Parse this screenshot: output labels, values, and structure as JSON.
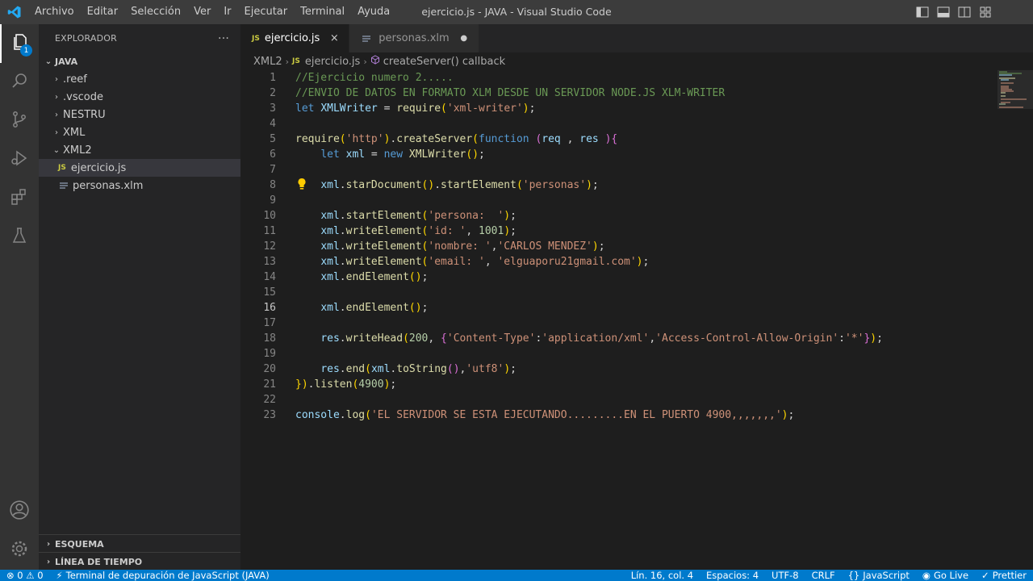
{
  "menu": [
    "Archivo",
    "Editar",
    "Selección",
    "Ver",
    "Ir",
    "Ejecutar",
    "Terminal",
    "Ayuda"
  ],
  "window_title": "ejercicio.js - JAVA - Visual Studio Code",
  "activity": {
    "explorer_badge": "1"
  },
  "sidebar": {
    "header": "EXPLORADOR",
    "more": "···",
    "root": "JAVA",
    "folders": [
      ".reef",
      ".vscode",
      "NESTRU",
      "XML"
    ],
    "open_folder": "XML2",
    "files": [
      "ejercicio.js",
      "personas.xlm"
    ],
    "js_badge": "JS",
    "outline": "ESQUEMA",
    "timeline": "LÍNEA DE TIEMPO"
  },
  "tabs": {
    "active": "ejercicio.js",
    "inactive": "personas.xlm",
    "js_badge": "JS",
    "close": "×",
    "dirty": "●"
  },
  "breadcrumb": {
    "folder": "XML2",
    "file": "ejercicio.js",
    "symbol": "createServer() callback"
  },
  "editor": {
    "current_line": 16,
    "lines": [
      "//Ejercicio numero 2.....",
      "//ENVIO DE DATOS EN FORMATO XLM DESDE UN SERVIDOR NODE.JS XLM-WRITER",
      "let XMLWriter = require('xml-writer');",
      "",
      "require('http').createServer(function (req , res ){",
      "    let xml = new XMLWriter();",
      "",
      "    xml.starDocument().startElement('personas');",
      "",
      "    xml.startElement('persona:  ');",
      "    xml.writeElement('id: ', 1001);",
      "    xml.writeElement('nombre: ','CARLOS MENDEZ');",
      "    xml.writeElement('email: ', 'elguaporu21gmail.com');",
      "    xml.endElement();",
      "",
      "    xml.endElement();",
      "",
      "    res.writeHead(200, {'Content-Type':'application/xml','Access-Control-Allow-Origin':'*'});",
      "",
      "    res.end(xml.toString(),'utf8');",
      "}).listen(4900);",
      "",
      "console.log('EL SERVIDOR SE ESTA EJECUTANDO.........EN EL PUERTO 4900,,,,,,,');"
    ]
  },
  "statusbar": {
    "problems": "⊗ 0 ⚠ 0",
    "debug_terminal": "Terminal de depuración de JavaScript (JAVA)",
    "position": "Lín. 16, col. 4",
    "spaces": "Espacios: 4",
    "encoding": "UTF-8",
    "eol": "CRLF",
    "language": "JavaScript",
    "golive": "Go Live",
    "prettier": "Prettier"
  },
  "colors": {
    "accent": "#007acc",
    "titlebar": "#3c3c3c",
    "activitybar": "#333333",
    "sidebar": "#252526",
    "editor": "#1e1e1e"
  }
}
